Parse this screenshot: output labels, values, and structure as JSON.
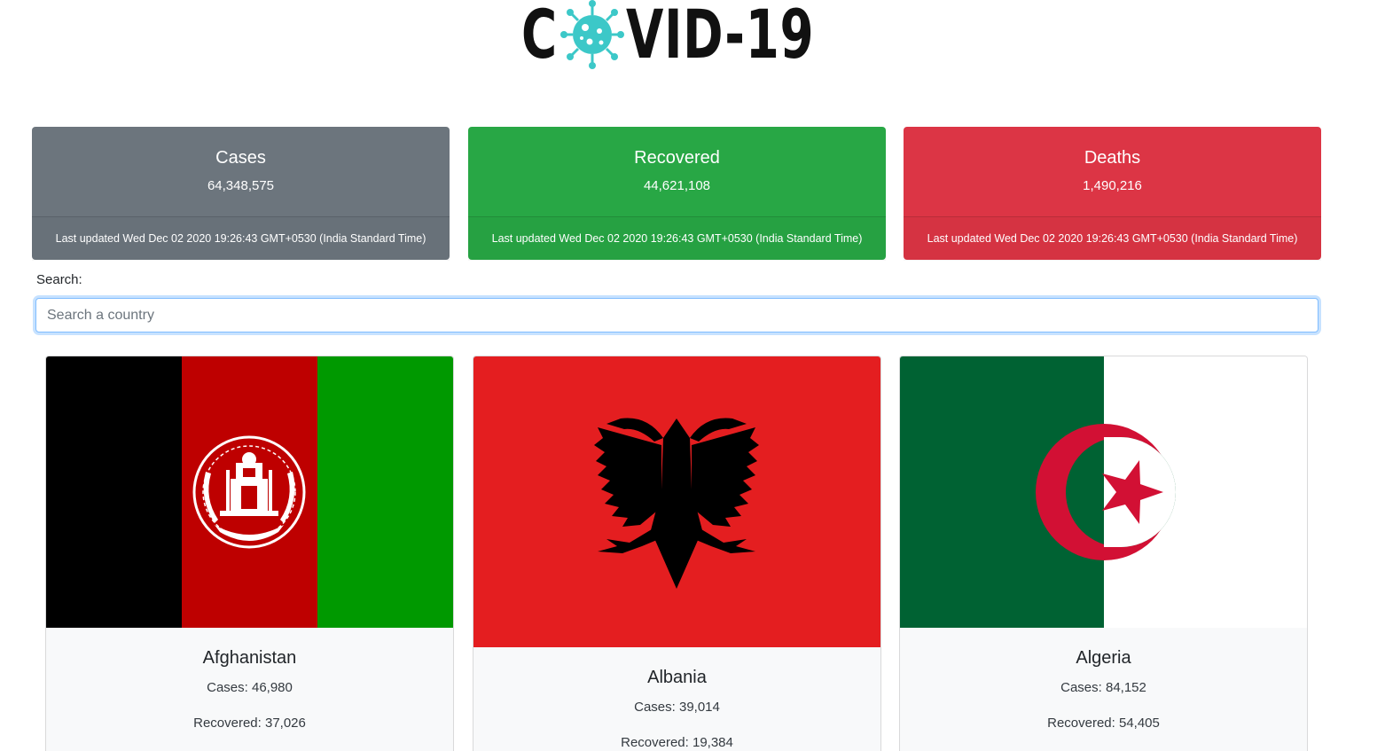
{
  "logo": {
    "first_letter": "C",
    "rest": "VID-19",
    "virus_icon": "coronavirus-icon",
    "virus_color": "#3cc8c8"
  },
  "stats": {
    "cases": {
      "title": "Cases",
      "count": "64,348,575",
      "updated": "Last updated Wed Dec 02 2020 19:26:43 GMT+0530 (India Standard Time)",
      "color": "#6c757d"
    },
    "recovered": {
      "title": "Recovered",
      "count": "44,621,108",
      "updated": "Last updated Wed Dec 02 2020 19:26:43 GMT+0530 (India Standard Time)",
      "color": "#28a745"
    },
    "deaths": {
      "title": "Deaths",
      "count": "1,490,216",
      "updated": "Last updated Wed Dec 02 2020 19:26:43 GMT+0530 (India Standard Time)",
      "color": "#dc3545"
    }
  },
  "search": {
    "label": "Search:",
    "placeholder": "Search a country",
    "value": ""
  },
  "countries": [
    {
      "name": "Afghanistan",
      "cases": "Cases: 46,980",
      "recovered": "Recovered: 37,026",
      "flag_icon": "afghanistan-flag"
    },
    {
      "name": "Albania",
      "cases": "Cases: 39,014",
      "recovered": "Recovered: 19,384",
      "flag_icon": "albania-flag"
    },
    {
      "name": "Algeria",
      "cases": "Cases: 84,152",
      "recovered": "Recovered: 54,405",
      "flag_icon": "algeria-flag"
    }
  ]
}
